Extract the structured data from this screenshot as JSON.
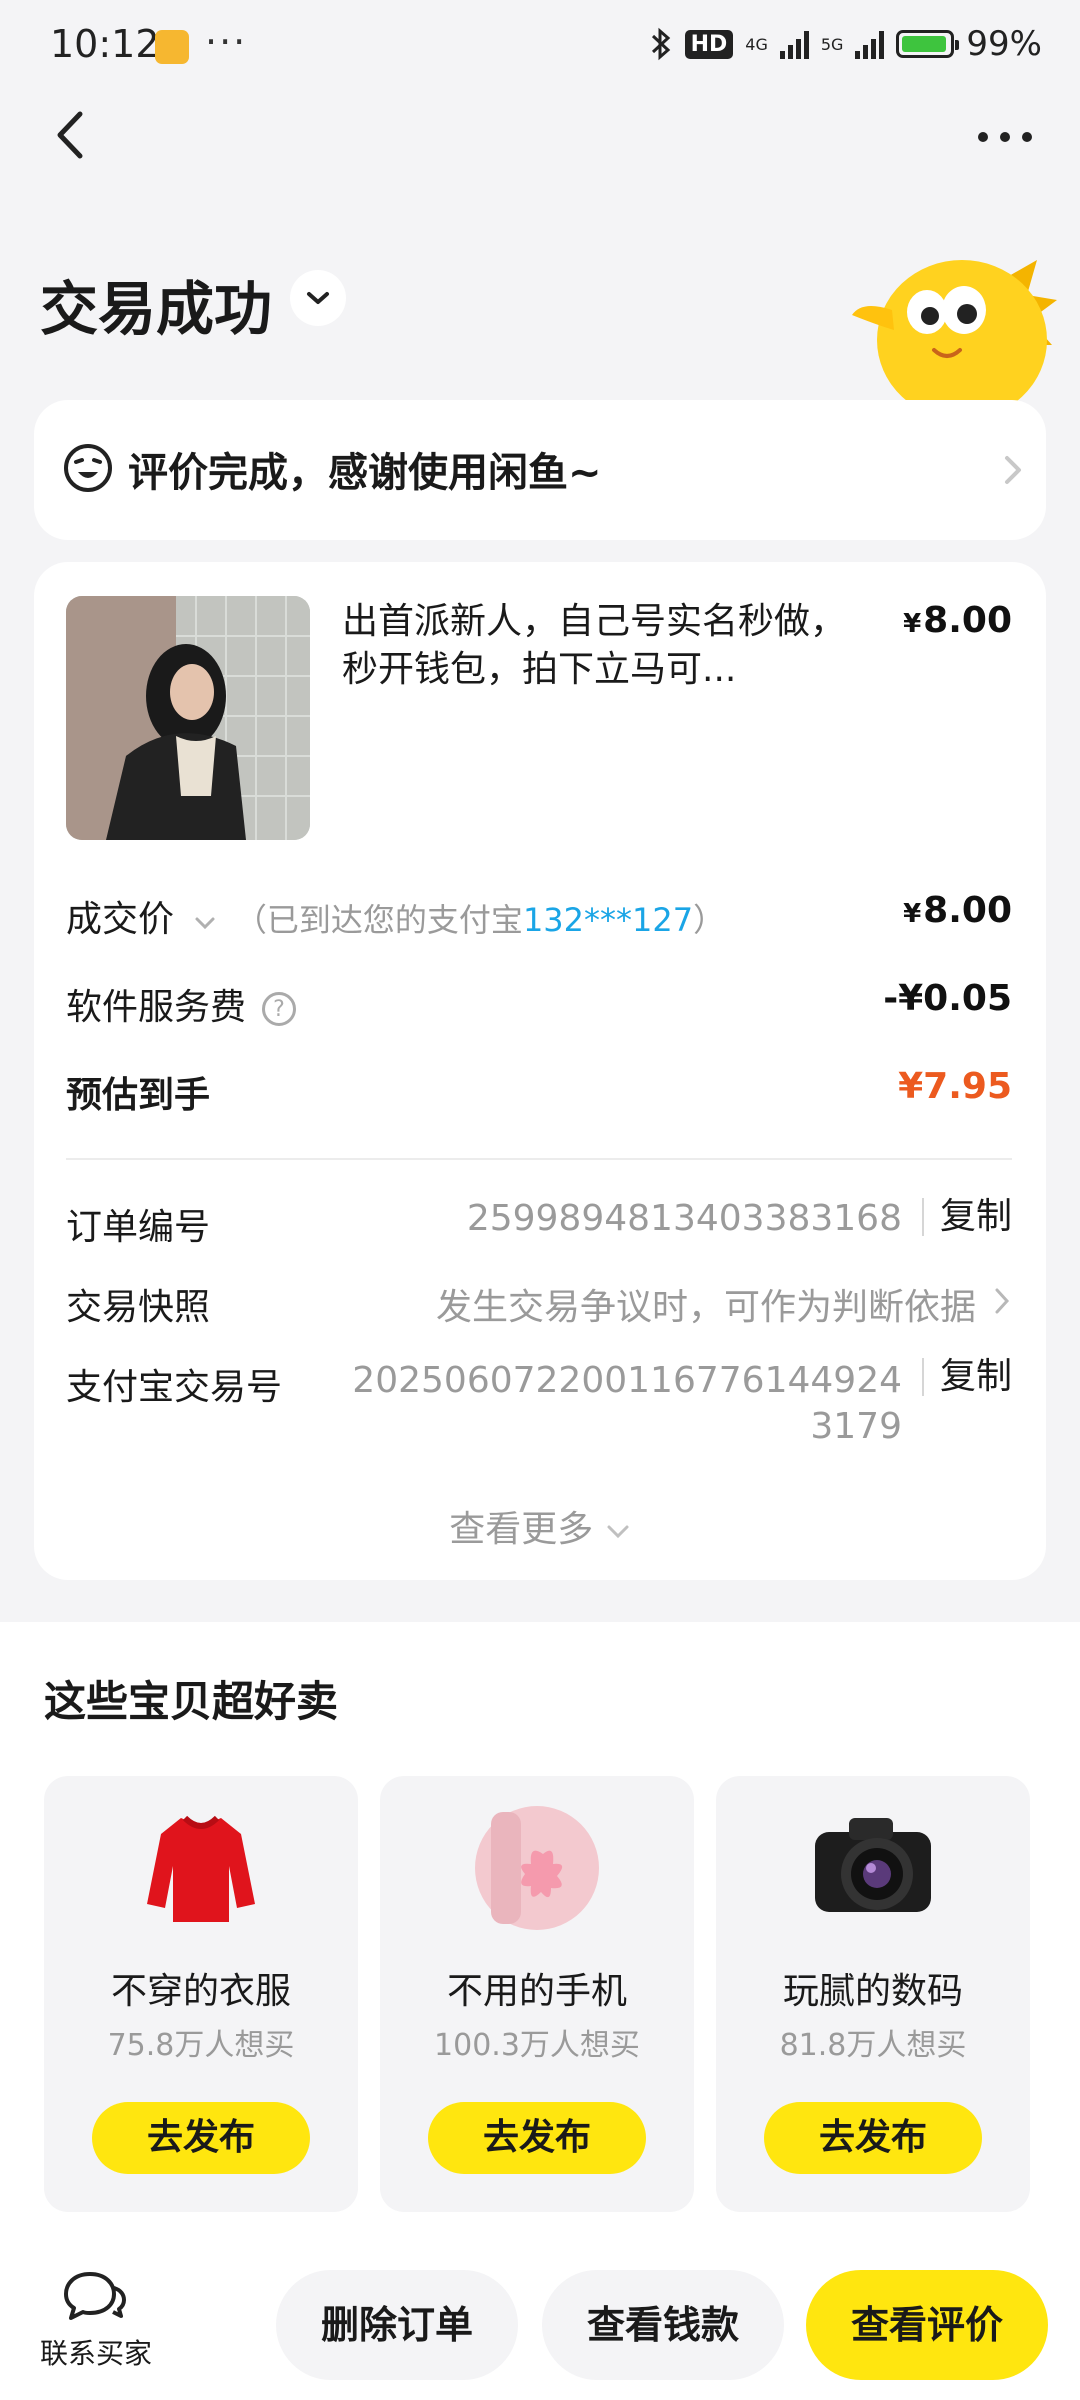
{
  "status_bar": {
    "time": "10:12",
    "more": "···",
    "hd_label": "HD",
    "net1": "4G",
    "net2": "5G",
    "battery": "99%"
  },
  "page": {
    "title": "交易成功"
  },
  "evaluation": {
    "text": "评价完成，感谢使用闲鱼~"
  },
  "order": {
    "item_title": "出首派新人，自己号实名秒做，秒开钱包，拍下立马可...",
    "item_price": "8.00",
    "currency": "¥",
    "deal_price_label": "成交价",
    "deal_hint_prefix": "（已到达您的支付宝",
    "deal_hint_account": "132***127",
    "deal_hint_suffix": "）",
    "deal_price": "8.00",
    "fee_label": "软件服务费",
    "fee_value": "-¥0.05",
    "net_label": "预估到手",
    "net_value": "¥7.95",
    "order_no_label": "订单编号",
    "order_no": "2599894813403383168",
    "copy_label": "复制",
    "snapshot_label": "交易快照",
    "snapshot_value": "发生交易争议时，可作为判断依据",
    "alipay_no_label": "支付宝交易号",
    "alipay_no_line1": "20250607220011677614492​4",
    "alipay_no_line2": "3179",
    "more_link": "查看更多"
  },
  "recommend": {
    "title": "这些宝贝超好卖",
    "items": [
      {
        "name": "不穿的衣服",
        "count": "75.8万人想买",
        "button": "去发布"
      },
      {
        "name": "不用的手机",
        "count": "100.3万人想买",
        "button": "去发布"
      },
      {
        "name": "玩腻的数码",
        "count": "81.8万人想买",
        "button": "去发布"
      }
    ]
  },
  "bottom_bar": {
    "contact_label": "联系买家",
    "delete_label": "删除订单",
    "money_label": "查看钱款",
    "review_label": "查看评价"
  },
  "colors": {
    "accent_yellow": "#ffe60f",
    "price_orange": "#ec5a1f",
    "link_blue": "#1aa5e6"
  }
}
